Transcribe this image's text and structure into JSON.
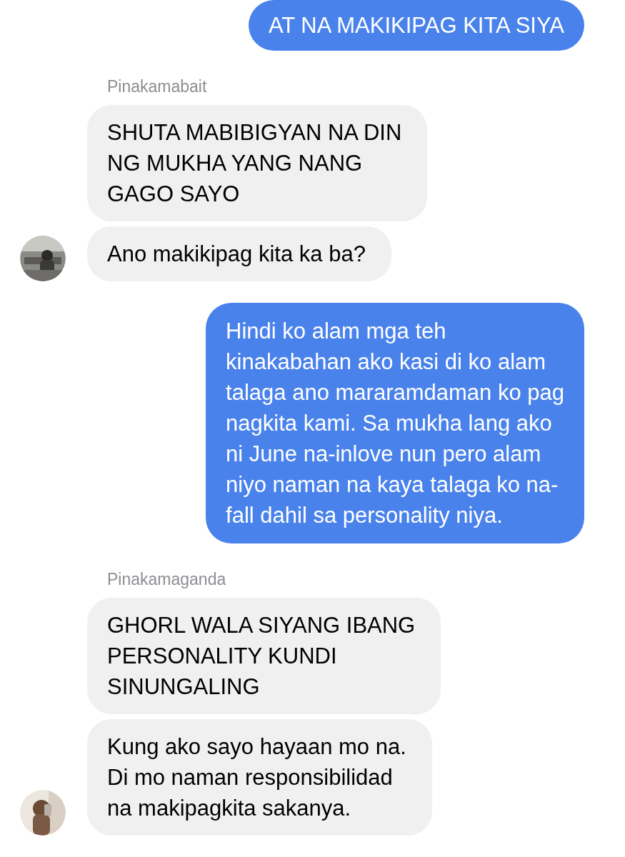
{
  "messages": [
    {
      "kind": "sent",
      "bubbles": [
        "AT NA MAKIKIPAG KITA SIYA"
      ]
    },
    {
      "kind": "received",
      "sender": "Pinakamabait",
      "bubbles": [
        "SHUTA MABIBIGYAN NA DIN\nNG MUKHA YANG NANG\nGAGO SAYO",
        "Ano makikipag kita ka ba?"
      ]
    },
    {
      "kind": "sent",
      "bubbles": [
        "Hindi ko alam mga teh\nkinakabahan ako kasi di ko alam\ntalaga ano mararamdaman ko pag\nnagkita kami. Sa mukha lang ako\nni June na-inlove nun pero alam\nniyo naman na kaya talaga ko na-\nfall dahil sa personality niya."
      ]
    },
    {
      "kind": "received",
      "sender": "Pinakamaganda",
      "bubbles": [
        "GHORL WALA SIYANG IBANG\nPERSONALITY KUNDI\nSINUNGALING",
        "Kung ako sayo hayaan mo na.\nDi mo naman responsibilidad\nna makipagkita sakanya."
      ]
    }
  ]
}
